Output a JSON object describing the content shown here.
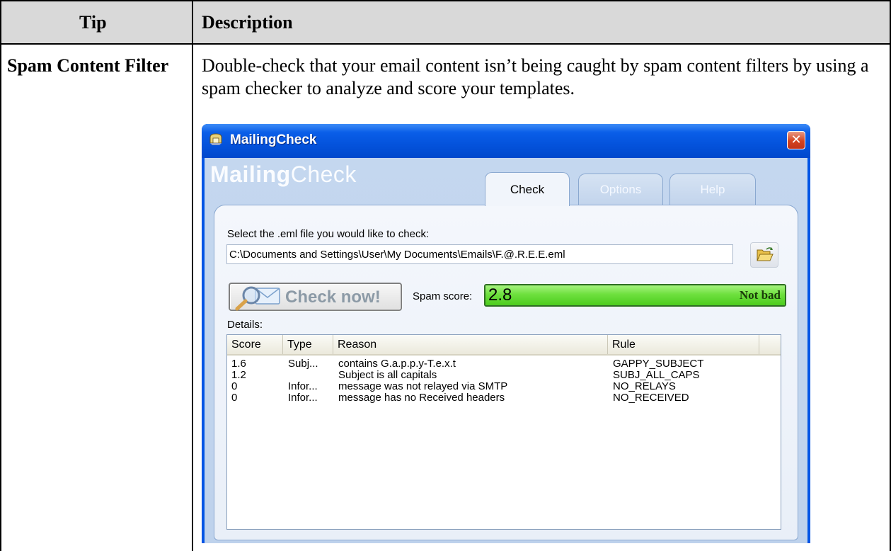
{
  "document": {
    "header": {
      "col1": "Tip",
      "col2": "Description"
    },
    "row": {
      "tip": "Spam Content Filter",
      "description": "Double-check that your email content isn’t being caught by spam content filters by using a spam checker to analyze and score your templates."
    }
  },
  "window": {
    "title": "MailingCheck",
    "close_glyph": "✕",
    "brand_bold": "Mailing",
    "brand_light": "Check",
    "tabs": [
      {
        "label": "Check",
        "active": true
      },
      {
        "label": "Options",
        "active": false
      },
      {
        "label": "Help",
        "active": false
      }
    ],
    "file": {
      "label": "Select the .eml file you would like to check:",
      "value": "C:\\Documents and Settings\\User\\My Documents\\Emails\\F.@.R.E.E.eml",
      "browse_icon": "folder-open-icon"
    },
    "check_button": "Check now!",
    "spam": {
      "label": "Spam score:",
      "value": "2.8",
      "verdict": "Not bad",
      "fill_fraction": 1.0
    },
    "details_label": "Details:",
    "columns": [
      "Score",
      "Type",
      "Reason",
      "Rule"
    ],
    "rows": [
      {
        "score": "1.6",
        "type": "Subj...",
        "reason": "contains G.a.p.p.y-T.e.x.t",
        "rule": "GAPPY_SUBJECT"
      },
      {
        "score": "1.2",
        "type": "",
        "reason": "Subject is all capitals",
        "rule": "SUBJ_ALL_CAPS"
      },
      {
        "score": "0",
        "type": "Infor...",
        "reason": "message was not relayed via SMTP",
        "rule": "NO_RELAYS"
      },
      {
        "score": "0",
        "type": "Infor...",
        "reason": "message has no Received headers",
        "rule": "NO_RECEIVED"
      }
    ],
    "colors": {
      "titlebar": "#0453dc",
      "score_fill": "#6ee03e",
      "close": "#d4431f"
    }
  }
}
